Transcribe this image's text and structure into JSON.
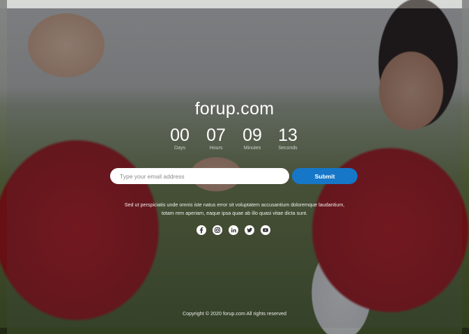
{
  "site": {
    "title": "forup.com"
  },
  "countdown": [
    {
      "value": "00",
      "label": "Days"
    },
    {
      "value": "07",
      "label": "Hours"
    },
    {
      "value": "09",
      "label": "Minutes"
    },
    {
      "value": "13",
      "label": "Seconds"
    }
  ],
  "subscribe": {
    "placeholder": "Type your email address",
    "button_label": "Submit",
    "button_color": "#1677c9"
  },
  "description": "Sed ut perspiciatis unde omnis iste natus error sit voluptatem accusantium doloremque laudantium, totam rem aperiam, eaque ipsa quae ab illo quasi vitae dicta sunt.",
  "social": [
    "facebook-icon",
    "instagram-icon",
    "linkedin-icon",
    "twitter-icon",
    "youtube-icon"
  ],
  "footer": {
    "copyright": "Copyright © 2020 forup.com All rights reserved"
  }
}
